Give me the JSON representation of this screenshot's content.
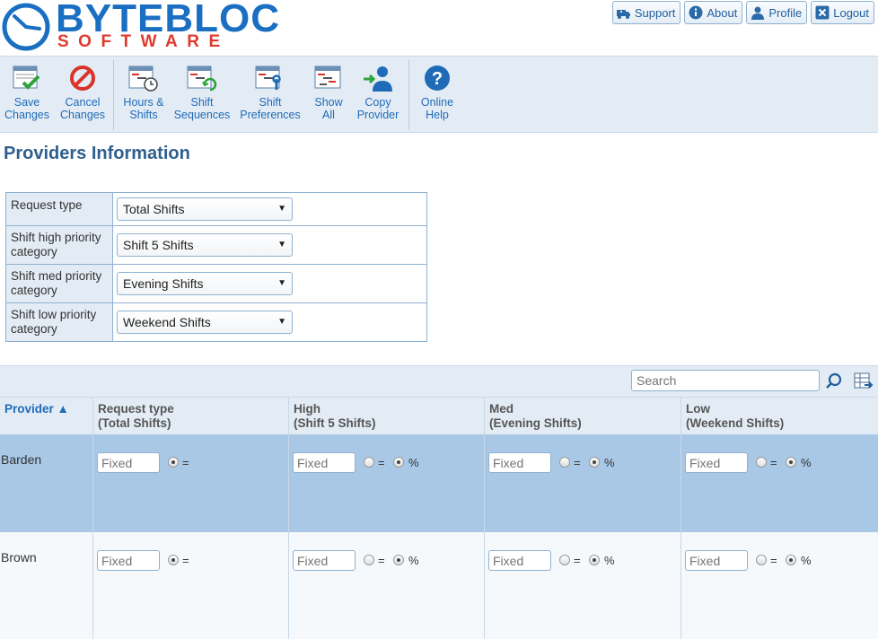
{
  "brand": {
    "name": "BYTEBLOC",
    "sub": "SOFTWARE"
  },
  "top_links": [
    {
      "label": "Support",
      "icon": "ambulance-icon"
    },
    {
      "label": "About",
      "icon": "info-icon"
    },
    {
      "label": "Profile",
      "icon": "user-icon"
    },
    {
      "label": "Logout",
      "icon": "close-icon"
    }
  ],
  "toolbar": {
    "save": "Save Changes",
    "cancel": "Cancel Changes",
    "hours": "Hours & Shifts",
    "sequences": "Shift Sequences",
    "preferences": "Shift Preferences",
    "show_all": "Show All",
    "copy": "Copy Provider",
    "help": "Online Help"
  },
  "page_title": "Providers Information",
  "form": [
    {
      "label": "Request type",
      "value": "Total Shifts"
    },
    {
      "label": "Shift high priority category",
      "value": "Shift 5 Shifts"
    },
    {
      "label": "Shift med priority category",
      "value": "Evening Shifts"
    },
    {
      "label": "Shift low priority category",
      "value": "Weekend Shifts"
    }
  ],
  "grid": {
    "search_placeholder": "Search",
    "columns": [
      {
        "title": "Provider ▲"
      },
      {
        "title": "Request type",
        "sub": "(Total Shifts)"
      },
      {
        "title": "High",
        "sub": "(Shift 5 Shifts)"
      },
      {
        "title": "Med",
        "sub": "(Evening Shifts)"
      },
      {
        "title": "Low",
        "sub": "(Weekend Shifts)"
      }
    ],
    "fixed_placeholder": "Fixed",
    "eq": "=",
    "pct": "%",
    "rows": [
      {
        "name": "Barden",
        "selected": true
      },
      {
        "name": "Brown",
        "selected": false
      }
    ]
  },
  "colors": {
    "accent": "#1f6bb7",
    "toolbar_bg": "#e3ecf5",
    "selected_row": "#a9c8e6",
    "logo_red": "#e03a2e"
  }
}
